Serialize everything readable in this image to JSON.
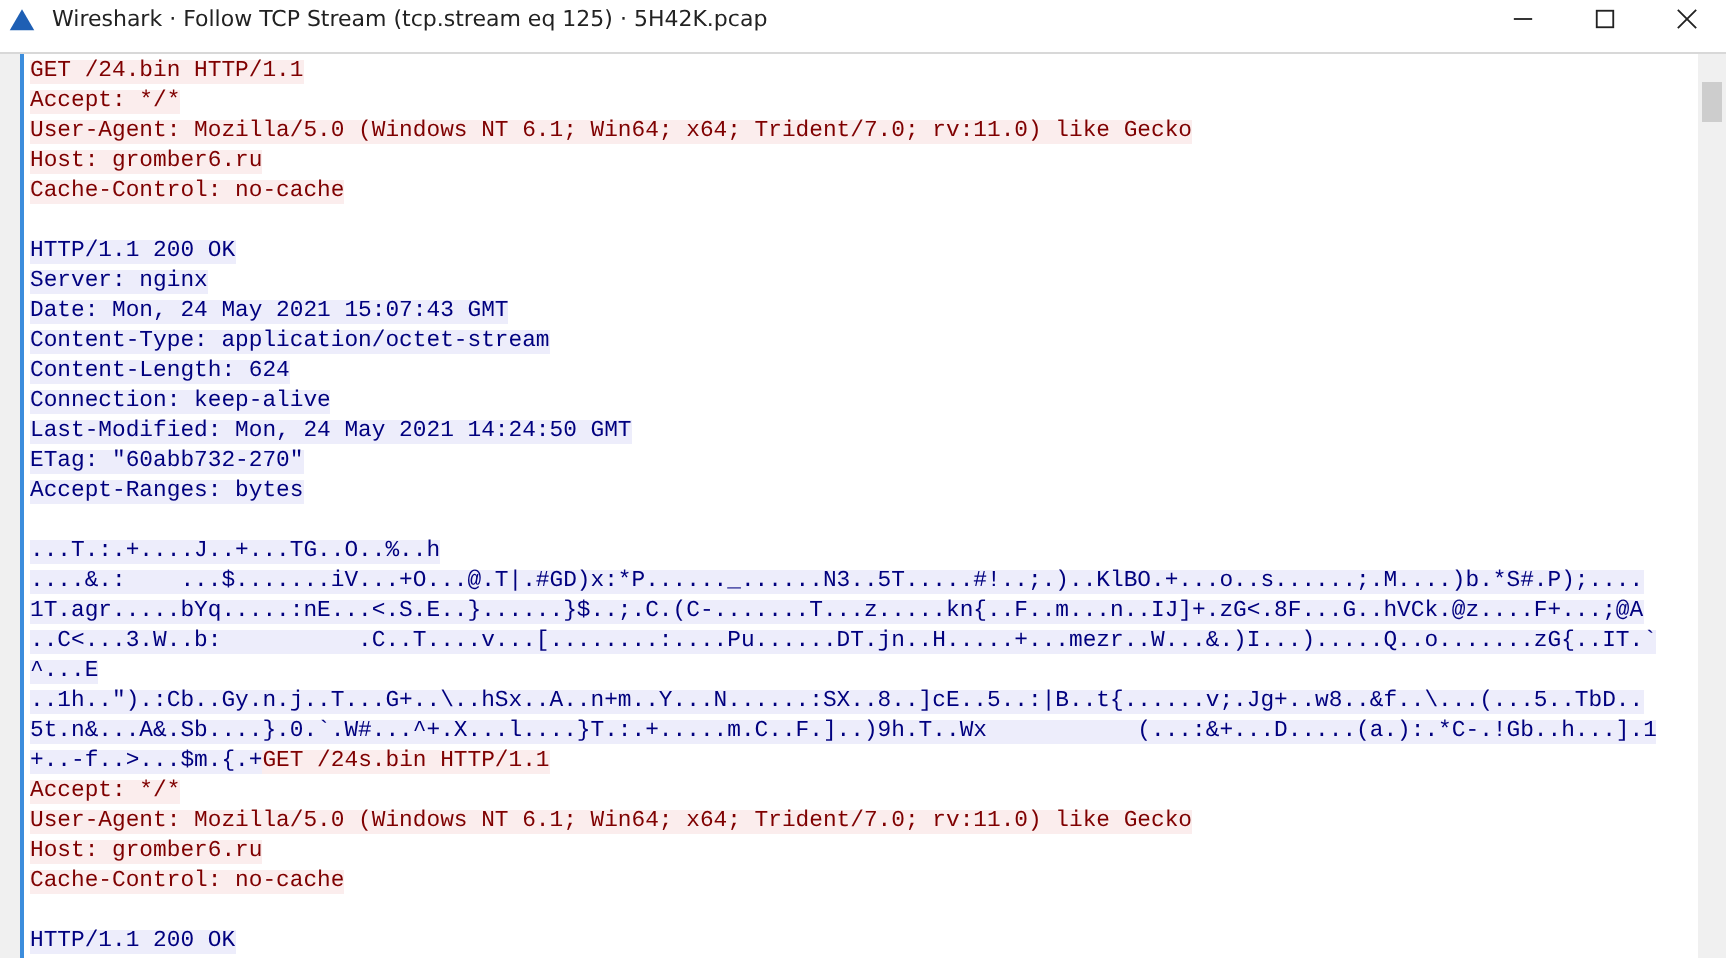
{
  "window": {
    "title": "Wireshark · Follow TCP Stream (tcp.stream eq 125) · 5H42K.pcap"
  },
  "stream": {
    "lines": [
      {
        "kind": "text",
        "segments": [
          {
            "kind": "client",
            "text": "GET /24.bin HTTP/1.1"
          }
        ]
      },
      {
        "kind": "text",
        "segments": [
          {
            "kind": "client",
            "text": "Accept: */*"
          }
        ]
      },
      {
        "kind": "text",
        "segments": [
          {
            "kind": "client",
            "text": "User-Agent: Mozilla/5.0 (Windows NT 6.1; Win64; x64; Trident/7.0; rv:11.0) like Gecko"
          }
        ]
      },
      {
        "kind": "text",
        "segments": [
          {
            "kind": "client",
            "text": "Host: gromber6.ru"
          }
        ]
      },
      {
        "kind": "text",
        "segments": [
          {
            "kind": "client",
            "text": "Cache-Control: no-cache"
          }
        ]
      },
      {
        "kind": "spacer"
      },
      {
        "kind": "text",
        "segments": [
          {
            "kind": "server",
            "text": "HTTP/1.1 200 OK"
          }
        ]
      },
      {
        "kind": "text",
        "segments": [
          {
            "kind": "server",
            "text": "Server: nginx"
          }
        ]
      },
      {
        "kind": "text",
        "segments": [
          {
            "kind": "server",
            "text": "Date: Mon, 24 May 2021 15:07:43 GMT"
          }
        ]
      },
      {
        "kind": "text",
        "segments": [
          {
            "kind": "server",
            "text": "Content-Type: application/octet-stream"
          }
        ]
      },
      {
        "kind": "text",
        "segments": [
          {
            "kind": "server",
            "text": "Content-Length: 624"
          }
        ]
      },
      {
        "kind": "text",
        "segments": [
          {
            "kind": "server",
            "text": "Connection: keep-alive"
          }
        ]
      },
      {
        "kind": "text",
        "segments": [
          {
            "kind": "server",
            "text": "Last-Modified: Mon, 24 May 2021 14:24:50 GMT"
          }
        ]
      },
      {
        "kind": "text",
        "segments": [
          {
            "kind": "server",
            "text": "ETag: \"60abb732-270\""
          }
        ]
      },
      {
        "kind": "text",
        "segments": [
          {
            "kind": "server",
            "text": "Accept-Ranges: bytes"
          }
        ]
      },
      {
        "kind": "spacer"
      },
      {
        "kind": "text",
        "segments": [
          {
            "kind": "server",
            "text": "...T.:.+....J..+...TG..O..%..h"
          }
        ]
      },
      {
        "kind": "text",
        "segments": [
          {
            "kind": "server",
            "text": "....&.:    ...$.......iV...+O...@.T|.#GD)x:*P......_......N3..5T.....#!..;.)..KlBO.+...o..s......;.M....)b.*S#.P);...."
          }
        ]
      },
      {
        "kind": "text",
        "segments": [
          {
            "kind": "server",
            "text": "1T.agr.....bYq.....:nE...<.S.E..}......}$..;.C.(C-.......T...z.....kn{..F..m...n..IJ]+.zG<.8F...G..hVCk.@z....F+...;@A"
          }
        ]
      },
      {
        "kind": "text",
        "segments": [
          {
            "kind": "server",
            "text": "..C<...3.W..b:          .C..T....v...[........:....Pu......DT.jn..H.....+...mezr..W...&.)I...).....Q..o.......zG{..IT.`"
          }
        ]
      },
      {
        "kind": "text",
        "segments": [
          {
            "kind": "server",
            "text": "^...E"
          }
        ]
      },
      {
        "kind": "text",
        "segments": [
          {
            "kind": "server",
            "text": "..1h..\").:Cb..Gy.n.j..T...G+..\\..hSx..A..n+m..Y...N......:SX..8..]cE..5..:|B..t{......v;.Jg+..w8..&f..\\...(...5..TbD.."
          }
        ]
      },
      {
        "kind": "text",
        "segments": [
          {
            "kind": "server",
            "text": "5t.n&...A&.Sb....}.0.`.W#...^+.X...l....}T.:.+.....m.C..F.]..)9h.T..Wx           (...:&+...D.....(a.):.*C-.!Gb..h...].1"
          }
        ]
      },
      {
        "kind": "text",
        "segments": [
          {
            "kind": "server",
            "text": "+..-f..>...$m.{.+"
          },
          {
            "kind": "client",
            "text": "GET /24s.bin HTTP/1.1"
          }
        ]
      },
      {
        "kind": "text",
        "segments": [
          {
            "kind": "client",
            "text": "Accept: */*"
          }
        ]
      },
      {
        "kind": "text",
        "segments": [
          {
            "kind": "client",
            "text": "User-Agent: Mozilla/5.0 (Windows NT 6.1; Win64; x64; Trident/7.0; rv:11.0) like Gecko"
          }
        ]
      },
      {
        "kind": "text",
        "segments": [
          {
            "kind": "client",
            "text": "Host: gromber6.ru"
          }
        ]
      },
      {
        "kind": "text",
        "segments": [
          {
            "kind": "client",
            "text": "Cache-Control: no-cache"
          }
        ]
      },
      {
        "kind": "spacer"
      },
      {
        "kind": "text",
        "segments": [
          {
            "kind": "server",
            "text": "HTTP/1.1 200 OK"
          }
        ]
      }
    ]
  }
}
